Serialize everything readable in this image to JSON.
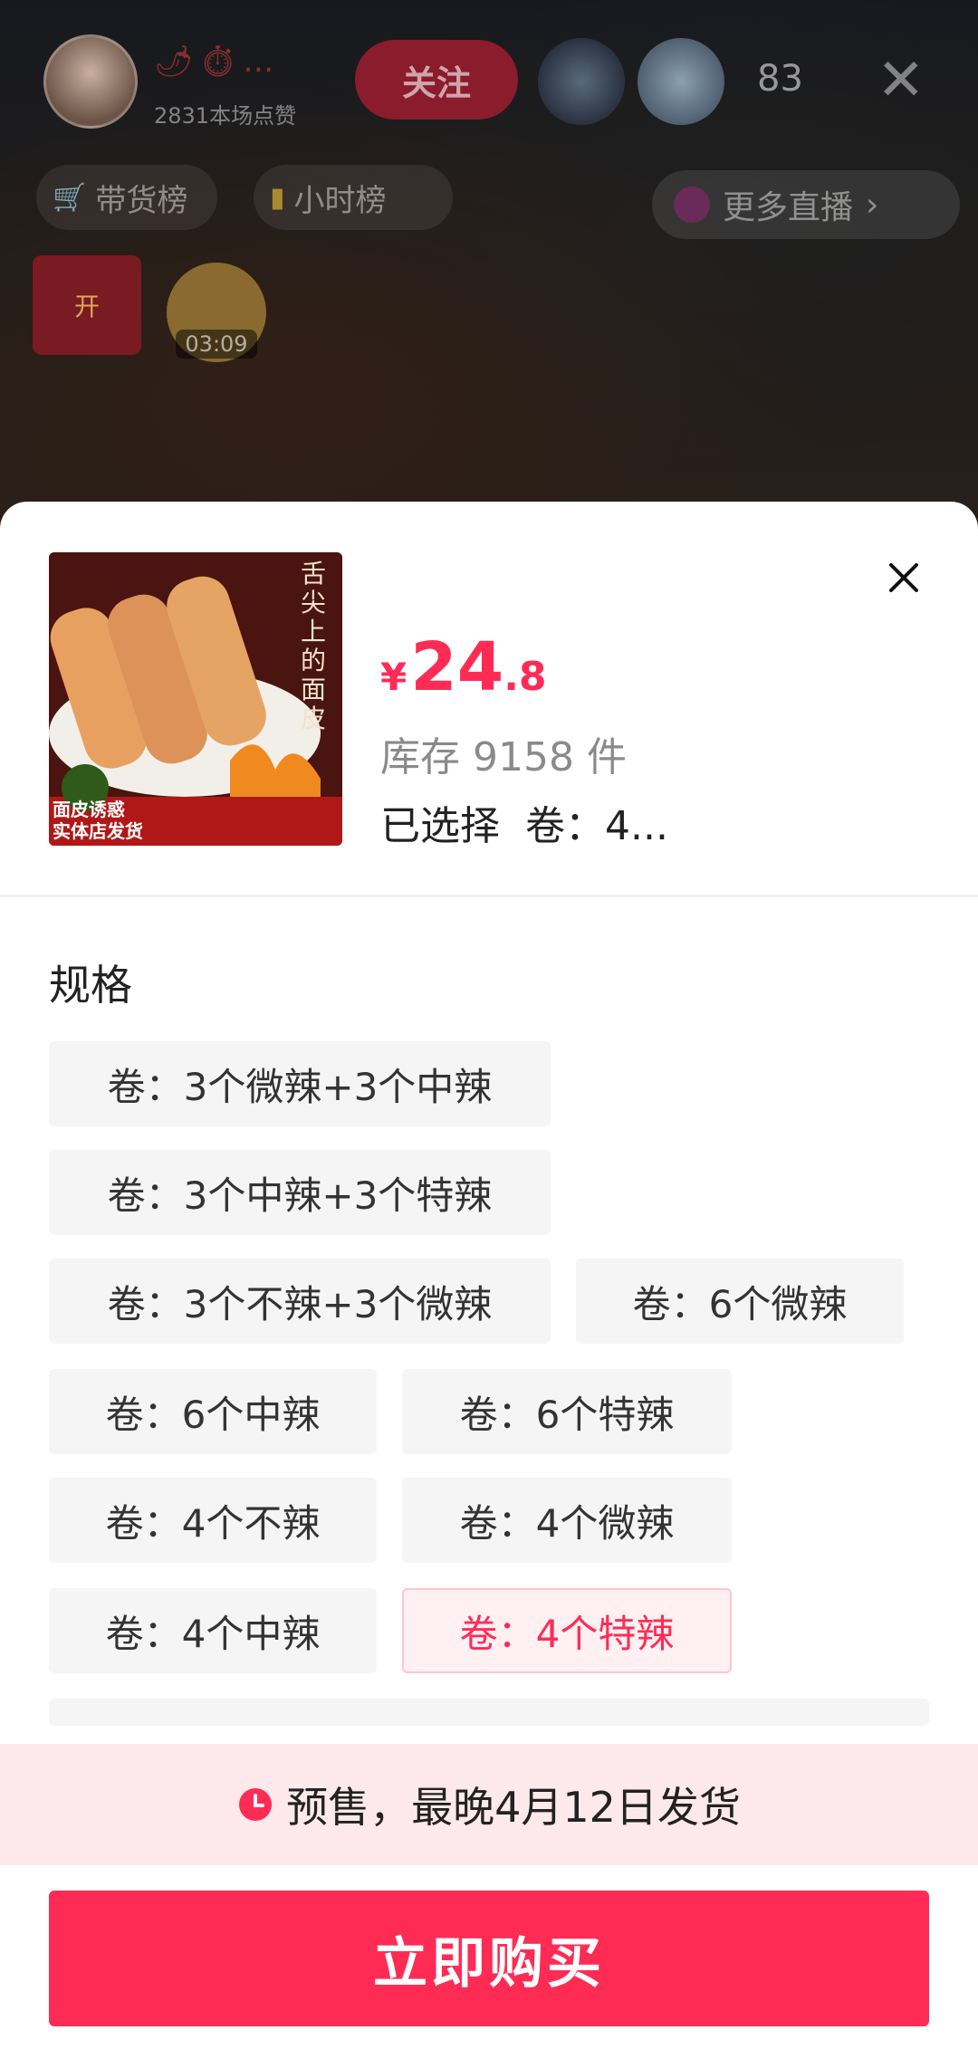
{
  "live": {
    "likes_text": "2831本场点赞",
    "follow_label": "关注",
    "viewer_count": "83",
    "rank_goods": "带货榜",
    "rank_hour": "小时榜",
    "more_live": "更多直播",
    "redpack_label": "开",
    "countdown": "03:09"
  },
  "product": {
    "image_caption_top": "舌尖上的面皮",
    "image_caption_bottom": "面皮诱惑\n实体店发货",
    "currency": "¥",
    "price_int": "24",
    "price_dec": ".8",
    "stock": "库存 9158 件",
    "selected": "已选择  卷：4..."
  },
  "spec": {
    "title": "规格",
    "options": [
      "卷：3个微辣+3个中辣",
      "卷：3个中辣+3个特辣",
      "卷：3个不辣+3个微辣",
      "卷：6个微辣",
      "卷：6个中辣",
      "卷：6个特辣",
      "卷：4个不辣",
      "卷：4个微辣",
      "卷：4个中辣",
      "卷：4个特辣"
    ],
    "selected_index": 9
  },
  "presale_text": "预售，最晚4月12日发货",
  "buy_label": "立即购买",
  "colors": {
    "accent": "#fe2c55",
    "presale_bg": "#fde9ec"
  }
}
